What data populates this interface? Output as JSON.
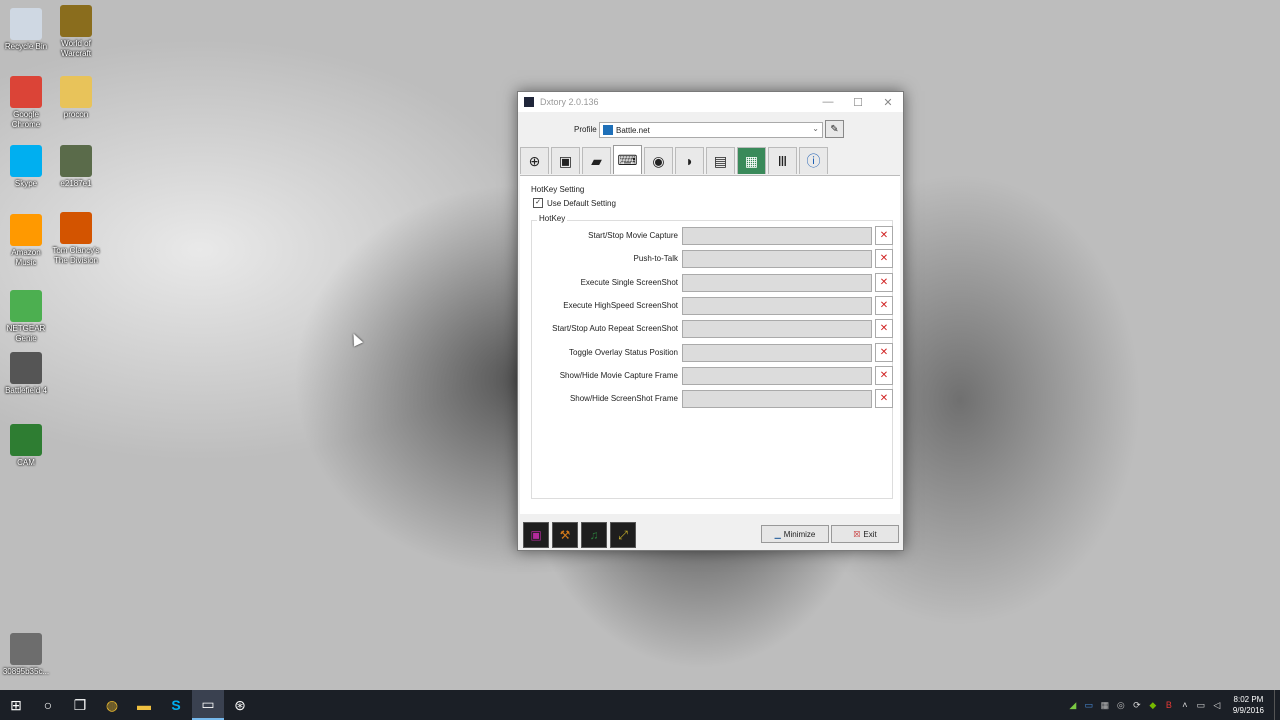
{
  "desktop": {
    "icons_left": [
      {
        "label": "Recycle Bin",
        "icon": "recycle-bin-icon",
        "color": "#cfd8e3"
      },
      {
        "label": "Google Chrome",
        "icon": "chrome-icon",
        "color": "#db4437"
      },
      {
        "label": "Skype",
        "icon": "skype-icon",
        "color": "#00aff0"
      },
      {
        "label": "Amazon Music",
        "icon": "amazon-music-icon",
        "color": "#ff9900"
      },
      {
        "label": "NETGEAR Genie",
        "icon": "netgear-icon",
        "color": "#4caf50"
      },
      {
        "label": "Battlefield 4",
        "icon": "battlefield-icon",
        "color": "#555555"
      },
      {
        "label": "CAM",
        "icon": "cam-icon",
        "color": "#2e7d32"
      },
      {
        "label": "30895b35c...",
        "icon": "image-file-icon",
        "color": "#6d6d6d"
      }
    ],
    "icons_right": [
      {
        "label": "World of Warcraft",
        "icon": "wow-icon",
        "color": "#8a6d1d"
      },
      {
        "label": "procon",
        "icon": "folder-icon",
        "color": "#e8c35a"
      },
      {
        "label": "e2187e1",
        "icon": "image-file-icon",
        "color": "#5a6b4a"
      },
      {
        "label": "Tom Clancy's The Division",
        "icon": "division-icon",
        "color": "#d35400"
      }
    ]
  },
  "window": {
    "title": "Dxtory 2.0.136",
    "minimize_glyph": "—",
    "maximize_glyph": "☐",
    "close_glyph": "✕",
    "profile_label": "Profile",
    "profile_value": "Battle.net",
    "tabs": [
      {
        "name": "crosshair-icon",
        "glyph": "⊕"
      },
      {
        "name": "monitor-icon",
        "glyph": "▣"
      },
      {
        "name": "folder-icon",
        "glyph": "▰"
      },
      {
        "name": "keyboard-icon",
        "glyph": "⌨"
      },
      {
        "name": "video-camera-icon",
        "glyph": "◉"
      },
      {
        "name": "headphones-icon",
        "glyph": "◗"
      },
      {
        "name": "camera-icon",
        "glyph": "▤"
      },
      {
        "name": "chip-icon",
        "glyph": "▦"
      },
      {
        "name": "tools-icon",
        "glyph": "Ⅲ"
      },
      {
        "name": "info-icon",
        "glyph": "ⓘ"
      }
    ],
    "active_tab": 3,
    "hotkey_setting_title": "HotKey Setting",
    "use_default_label": "Use Default Setting",
    "use_default_checked": true,
    "hotkey_group_title": "HotKey",
    "hotkeys": [
      {
        "label": "Start/Stop Movie Capture",
        "value": ""
      },
      {
        "label": "Push-to-Talk",
        "value": ""
      },
      {
        "label": "Execute Single ScreenShot",
        "value": ""
      },
      {
        "label": "Execute HighSpeed ScreenShot",
        "value": ""
      },
      {
        "label": "Start/Stop Auto Repeat ScreenShot",
        "value": ""
      },
      {
        "label": "Toggle Overlay Status Position",
        "value": ""
      },
      {
        "label": "Show/Hide Movie Capture Frame",
        "value": ""
      },
      {
        "label": "Show/Hide ScreenShot Frame",
        "value": ""
      }
    ],
    "clear_glyph": "✕",
    "bottom_icons": [
      {
        "name": "overlay-icon",
        "color": "#b32a9c"
      },
      {
        "name": "wrench-icon",
        "color": "#d47a1a"
      },
      {
        "name": "music-icon",
        "color": "#2a7a3a"
      },
      {
        "name": "expand-icon",
        "color": "#c9b02a"
      }
    ],
    "minimize_label": "Minimize",
    "exit_label": "Exit"
  },
  "taskbar": {
    "items": [
      {
        "name": "start-button",
        "glyph": "⊞"
      },
      {
        "name": "cortana-search-icon",
        "glyph": "○"
      },
      {
        "name": "task-view-icon",
        "glyph": "❐"
      },
      {
        "name": "chrome-taskbar-icon",
        "glyph": "◍"
      },
      {
        "name": "file-explorer-icon",
        "glyph": "▬"
      },
      {
        "name": "skype-taskbar-icon",
        "glyph": "S"
      },
      {
        "name": "dxtory-taskbar-icon",
        "glyph": "▭"
      },
      {
        "name": "steam-taskbar-icon",
        "glyph": "⊛"
      }
    ],
    "active_item": 6,
    "tray_icons": [
      "wifi-signal-icon",
      "dxtory-tray-icon",
      "network-icon",
      "steam-tray-icon",
      "sync-icon",
      "nvidia-icon",
      "bitdefender-icon",
      "chevron-up-icon",
      "network-status-icon",
      "volume-icon"
    ],
    "time": "8:02 PM",
    "date": "9/9/2016"
  }
}
